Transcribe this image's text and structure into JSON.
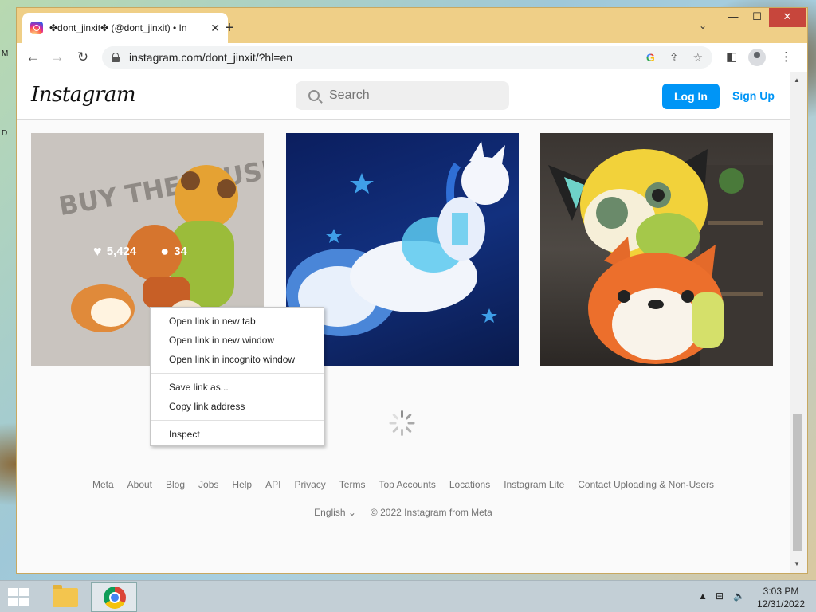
{
  "desktop": {
    "labels": [
      "M",
      "D"
    ]
  },
  "browser": {
    "tab_title": "✤dont_jinxit✤ (@dont_jinxit) • In",
    "new_tab": "+",
    "tab_search": "⌄",
    "window_controls": {
      "minimize": "—",
      "maximize": "☐",
      "close": "✕"
    },
    "nav": {
      "back": "←",
      "forward": "→",
      "reload": "↻"
    },
    "url": "instagram.com/dont_jinxit/?hl=en"
  },
  "instagram": {
    "logo": "Instagram",
    "search_placeholder": "Search",
    "login_label": "Log In",
    "signup_label": "Sign Up",
    "posts": [
      {
        "likes": "5,424",
        "comments": "34",
        "overlay_text": "BUY THE PLUSHIE!"
      },
      {},
      {}
    ],
    "footer_links": [
      "Meta",
      "About",
      "Blog",
      "Jobs",
      "Help",
      "API",
      "Privacy",
      "Terms",
      "Top Accounts",
      "Locations",
      "Instagram Lite",
      "Contact Uploading & Non-Users"
    ],
    "language": "English",
    "copyright": "© 2022 Instagram from Meta"
  },
  "context_menu": {
    "items": [
      "Open link in new tab",
      "Open link in new window",
      "Open link in incognito window",
      "Save link as...",
      "Copy link address",
      "Inspect"
    ]
  },
  "taskbar": {
    "time": "3:03 PM",
    "date": "12/31/2022"
  }
}
